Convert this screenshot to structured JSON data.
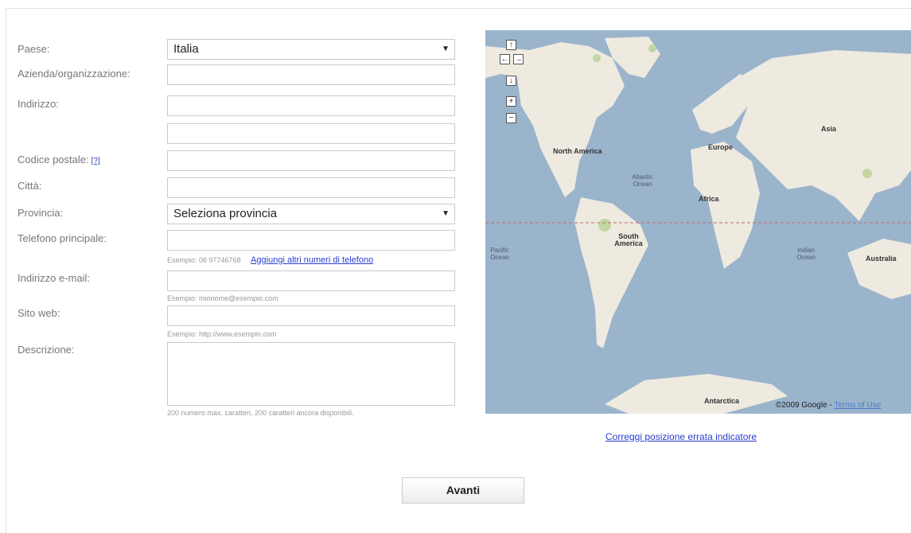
{
  "form": {
    "country_label": "Paese:",
    "country_value": "Italia",
    "org_label": "Azienda/organizzazione:",
    "address_label": "Indirizzo:",
    "postal_label": "Codice postale:",
    "postal_help": "[?]",
    "city_label": "Città:",
    "province_label": "Provincia:",
    "province_value": "Seleziona provincia",
    "phone_label": "Telefono principale:",
    "phone_hint": "Esempio: 06 97746768",
    "phone_more_link": "Aggiungi altri numeri di telefono",
    "email_label": "Indirizzo e-mail:",
    "email_hint": "Esempio: mionome@esempio.com",
    "website_label": "Sito web:",
    "website_hint": "Esempio: http://www.esempio.com",
    "desc_label": "Descrizione:",
    "desc_hint": "200 numero max. caratteri, 200 caratteri ancora disponibili."
  },
  "map": {
    "labels": {
      "north_america": "North America",
      "south_america": "South America",
      "europe": "Europe",
      "asia": "Asia",
      "africa": "Africa",
      "australia": "Australia",
      "antarctica": "Antarctica",
      "atlantic": "Atlantic Ocean",
      "pacific": "Pacific Ocean",
      "indian": "Indian Ocean"
    },
    "copyright": "©2009 Google - ",
    "terms": "Terms of Use",
    "fix_link": "Correggi posizione errata indicatore"
  },
  "actions": {
    "next_label": "Avanti"
  }
}
